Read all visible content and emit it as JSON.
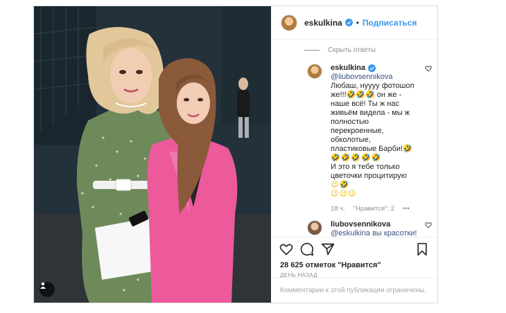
{
  "header": {
    "username": "eskulkina",
    "separator": "•",
    "follow_label": "Подписаться"
  },
  "comments": {
    "hide_replies_label": "Скрыть ответы",
    "reply1": {
      "username": "eskulkina",
      "mention": "@liubovsennikova",
      "lines": [
        "Любаш, нуууу фотошоп",
        "же!!!🤣🤣🤣 он же -",
        "наше всё! Ты ж нас",
        "живьём видела - мы ж",
        "полностью",
        "перекроенные,",
        "обколотые,",
        "пластиковые Барби!🤣",
        "🤣🤣🤣🤣🤣",
        "И это я тебе только",
        "цветочки процитирую",
        "😉🤣",
        "😉😉😉"
      ],
      "time": "18 ч.",
      "likes": "\"Нравится\": 2",
      "more": "•••"
    },
    "reply2": {
      "username": "liubovsennikova",
      "text": "@eskulkina вы красотки!"
    }
  },
  "actions": {
    "likes_count": "28 625 отметок \"Нравится\"",
    "timestamp": "ДЕНЬ НАЗАД",
    "comments_disabled": "Комментарии к этой публикации ограничены."
  },
  "icons": {
    "verified": "verified-badge-icon",
    "heart": "heart-icon",
    "comment": "comment-icon",
    "share": "share-icon",
    "save": "bookmark-icon",
    "user_tag": "user-tag-icon"
  },
  "colors": {
    "link": "#3897f0",
    "verified": "#3897f0",
    "dress": "#6e8a5a",
    "blazer": "#ec5a9c"
  }
}
